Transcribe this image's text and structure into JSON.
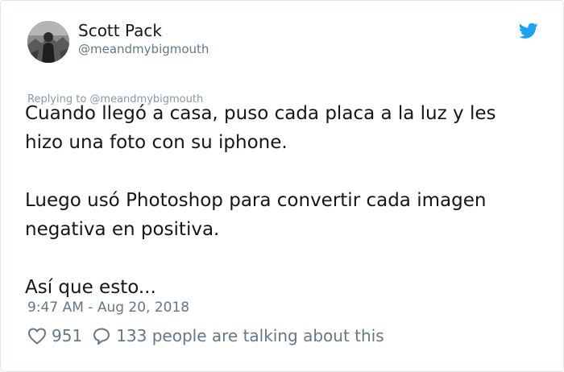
{
  "author": {
    "display_name": "Scott Pack",
    "handle": "@meandmybigmouth",
    "avatar_icon": "avatar-photo"
  },
  "brand_icon": "twitter-bird-icon",
  "brand_color": "#1da1f2",
  "reply": {
    "label": "Replying to @meandmybigmouth"
  },
  "tweet": {
    "paragraphs": [
      "Cuando llegó a casa, puso cada placa a la luz y les\nhizo una foto con su iphone.",
      "Luego usó Photoshop para convertir cada imagen\nnegativa en positiva.",
      "Así que esto..."
    ]
  },
  "timestamp": "9:47 AM - Aug 20, 2018",
  "stats": {
    "likes": "951",
    "talking": "133 people are talking about this",
    "like_icon": "heart-icon",
    "talk_icon": "speech-bubble-icon"
  }
}
